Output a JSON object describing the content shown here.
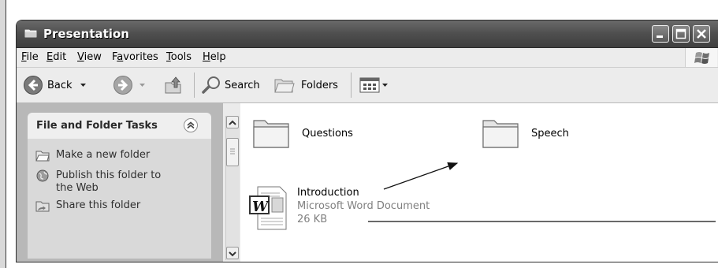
{
  "window": {
    "title": "Presentation"
  },
  "menu": {
    "items": [
      {
        "pre": "",
        "acc": "F",
        "post": "ile"
      },
      {
        "pre": "",
        "acc": "E",
        "post": "dit"
      },
      {
        "pre": "",
        "acc": "V",
        "post": "iew"
      },
      {
        "pre": "F",
        "acc": "a",
        "post": "vorites"
      },
      {
        "pre": "",
        "acc": "T",
        "post": "ools"
      },
      {
        "pre": "",
        "acc": "H",
        "post": "elp"
      }
    ]
  },
  "toolbar": {
    "back_label": "Back",
    "search_label": "Search",
    "folders_label": "Folders"
  },
  "tasks": {
    "title": "File and Folder Tasks",
    "items": [
      {
        "label": "Make a new folder",
        "icon": "new-folder-icon"
      },
      {
        "label_line1": "Publish this folder to",
        "label_line2": "the Web",
        "icon": "globe-icon"
      },
      {
        "label": "Share this folder",
        "icon": "share-folder-icon"
      }
    ]
  },
  "files": {
    "questions": {
      "name": "Questions"
    },
    "speech": {
      "name": "Speech"
    },
    "introduction": {
      "name": "Introduction",
      "type": "Microsoft Word Document",
      "size": "26 KB"
    }
  },
  "colors": {
    "titlebar": "#4e4e4e",
    "taskpane": "#b8b8b8",
    "toolbar": "#ececec"
  }
}
